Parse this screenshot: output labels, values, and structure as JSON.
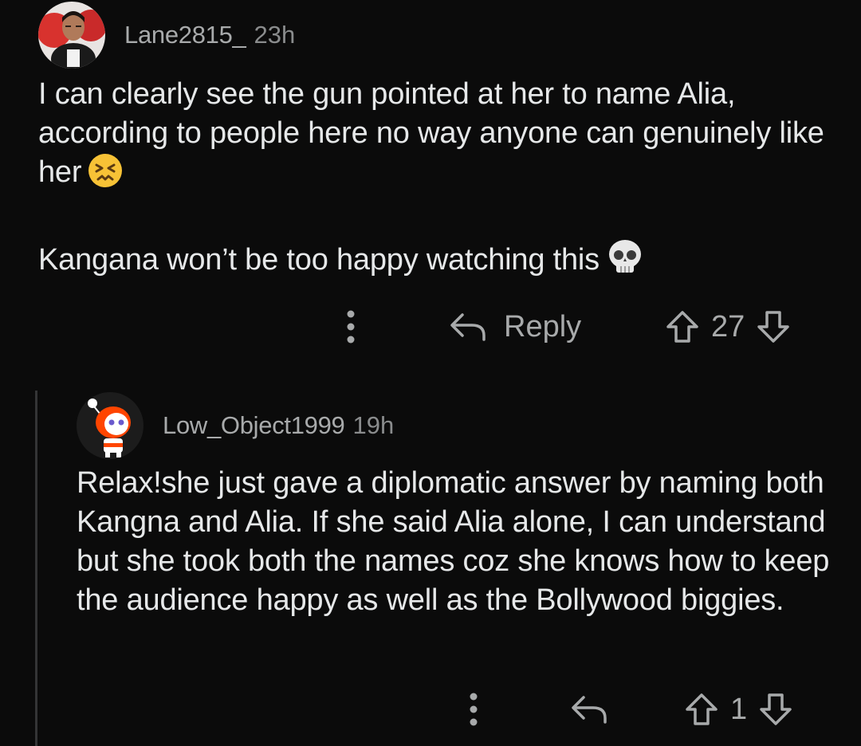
{
  "comments": [
    {
      "username": "Lane2815_",
      "time": "23h",
      "paragraph1": "I can clearly see the gun pointed at her to name Alia, according to people here no way anyone can genuinely like her",
      "paragraph2": "Kangana won’t be too happy watching this",
      "emoji1": "confounded-face-emoji",
      "emoji2": "skull-emoji",
      "reply_label": "Reply",
      "score": "27"
    },
    {
      "username": "Low_Object1999",
      "time": "19h",
      "paragraph1": "Relax!she just gave a diplomatic answer by naming both Kangna and Alia. If she said Alia alone, I can understand but she took both the names coz she knows how to keep the audience happy as well as the Bollywood biggies.",
      "score": "1"
    }
  ],
  "colors": {
    "background": "#0b0b0b",
    "text": "#e6e8e9",
    "meta": "#a8aaab",
    "thread_line": "#343536"
  },
  "icons": [
    "more-vertical-icon",
    "reply-arrow-icon",
    "upvote-icon",
    "downvote-icon"
  ]
}
